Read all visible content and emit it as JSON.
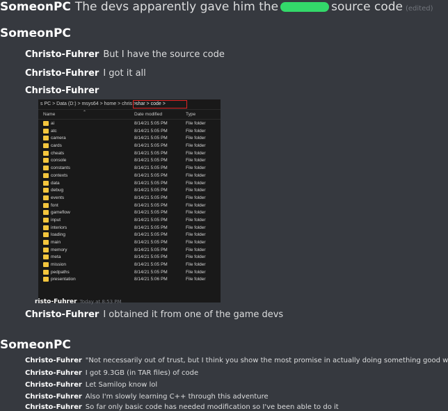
{
  "top_line": {
    "username": "SomeonPC",
    "text_before": "The devs apparently gave him the",
    "text_after": "source code",
    "edited": "(edited)"
  },
  "group1_author": "SomeonPC",
  "msgs_a": [
    {
      "author": "Christo-Fuhrer",
      "text": "But I have the source code"
    },
    {
      "author": "Christo-Fuhrer",
      "text": "I got it all"
    },
    {
      "author": "Christo-Fuhrer",
      "text": ""
    }
  ],
  "explorer": {
    "breadcrumb": "s PC  >  Data (D:)  >  msys64  >  home  >  chris  >",
    "highlight": "shar  >  code  >",
    "columns": {
      "name": "Name",
      "date": "Date modified",
      "type": "Type"
    },
    "rows": [
      {
        "name": "ai",
        "date": "8/14/21 5:05 PM",
        "type": "File folder"
      },
      {
        "name": "atc",
        "date": "8/14/21 5:05 PM",
        "type": "File folder"
      },
      {
        "name": "camera",
        "date": "8/14/21 5:05 PM",
        "type": "File folder"
      },
      {
        "name": "cards",
        "date": "8/14/21 5:05 PM",
        "type": "File folder"
      },
      {
        "name": "cheats",
        "date": "8/14/21 5:05 PM",
        "type": "File folder"
      },
      {
        "name": "console",
        "date": "8/14/21 5:05 PM",
        "type": "File folder"
      },
      {
        "name": "constants",
        "date": "8/14/21 5:05 PM",
        "type": "File folder"
      },
      {
        "name": "contexts",
        "date": "8/14/21 5:05 PM",
        "type": "File folder"
      },
      {
        "name": "data",
        "date": "8/14/21 5:05 PM",
        "type": "File folder"
      },
      {
        "name": "debug",
        "date": "8/14/21 5:05 PM",
        "type": "File folder"
      },
      {
        "name": "events",
        "date": "8/14/21 5:05 PM",
        "type": "File folder"
      },
      {
        "name": "font",
        "date": "8/14/21 5:05 PM",
        "type": "File folder"
      },
      {
        "name": "gameflow",
        "date": "8/14/21 5:05 PM",
        "type": "File folder"
      },
      {
        "name": "input",
        "date": "8/14/21 5:05 PM",
        "type": "File folder"
      },
      {
        "name": "interiors",
        "date": "8/14/21 5:05 PM",
        "type": "File folder"
      },
      {
        "name": "loading",
        "date": "8/14/21 5:05 PM",
        "type": "File folder"
      },
      {
        "name": "main",
        "date": "8/14/21 5:05 PM",
        "type": "File folder"
      },
      {
        "name": "memory",
        "date": "8/14/21 5:05 PM",
        "type": "File folder"
      },
      {
        "name": "meta",
        "date": "8/14/21 5:05 PM",
        "type": "File folder"
      },
      {
        "name": "mission",
        "date": "8/14/21 5:05 PM",
        "type": "File folder"
      },
      {
        "name": "pedpaths",
        "date": "8/14/21 5:05 PM",
        "type": "File folder"
      },
      {
        "name": "presentation",
        "date": "8/14/21 5:06 PM",
        "type": "File folder"
      }
    ]
  },
  "image_footer": {
    "author": "risto-Fuhrer",
    "timestamp": "Today at 8:53 PM"
  },
  "msg_b": {
    "author": "Christo-Fuhrer",
    "text": "I obtained it from one of the game devs"
  },
  "group2_author": "SomeonPC",
  "msgs_c": [
    {
      "author": "Christo-Fuhrer",
      "text": "\"Not necessarily out of trust, but I think you show the most promise in actually doing something good with it\""
    },
    {
      "author": "Christo-Fuhrer",
      "text": "I got 9.3GB (in TAR files) of code"
    },
    {
      "author": "Christo-Fuhrer",
      "text": "Let Samilop know lol"
    },
    {
      "author": "Christo-Fuhrer",
      "text": "Also I'm slowly learning C++ through this adventure"
    },
    {
      "author": "Christo-Fuhrer",
      "text": "So far only basic code has needed modification so I've been able to do it"
    }
  ]
}
